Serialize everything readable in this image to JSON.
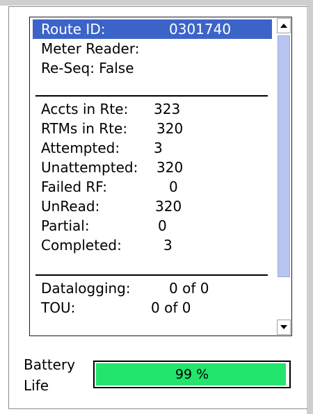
{
  "route_panel": {
    "rows": [
      {
        "label": "Route ID:",
        "value": "0301740"
      },
      {
        "label": "Meter Reader:",
        "value": ""
      },
      {
        "label": "Re-Seq: False",
        "value": ""
      },
      {
        "label": "Accts in Rte:",
        "value": "323"
      },
      {
        "label": "RTMs in Rte:",
        "value": "320"
      },
      {
        "label": "Attempted:",
        "value": "3"
      },
      {
        "label": "Unattempted:",
        "value": "320"
      },
      {
        "label": "Failed RF:",
        "value": "0"
      },
      {
        "label": "UnRead:",
        "value": "320"
      },
      {
        "label": "Partial:",
        "value": "0"
      },
      {
        "label": "Completed:",
        "value": "3"
      },
      {
        "label": "Datalogging:",
        "value": "0 of 0"
      },
      {
        "label": "TOU:",
        "value": "0 of 0"
      }
    ],
    "selected_index": 0
  },
  "scrollbar": {
    "up_icon": "arrow-up-icon",
    "down_icon": "arrow-down-icon",
    "thumb_color": "#b7c5f0"
  },
  "battery": {
    "label_line1": "Battery",
    "label_line2": "Life",
    "percent_text": "99 %",
    "level": 0.99,
    "fill_color": "#22e56e"
  },
  "colors": {
    "selection": "#3c64c8",
    "selection_text": "#ffffff"
  }
}
